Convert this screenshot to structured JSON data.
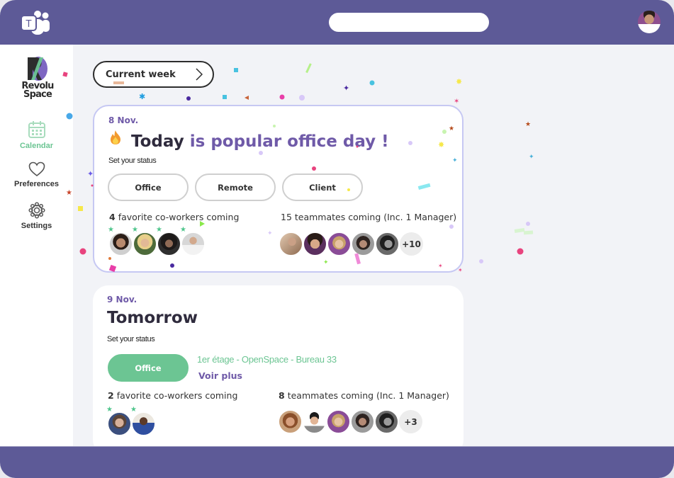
{
  "app": {
    "name": "Microsoft Teams",
    "logo_icon": "teams-logo-icon",
    "search": {
      "placeholder": "",
      "value": ""
    },
    "user_avatar": "user-avatar"
  },
  "sidebar": {
    "brand": {
      "line1": "Revolu",
      "line2": "Space"
    },
    "items": [
      {
        "label": "Calendar",
        "icon": "calendar-icon",
        "active": true
      },
      {
        "label": "Preferences",
        "icon": "heart-icon",
        "active": false
      },
      {
        "label": "Settings",
        "icon": "gear-icon",
        "active": false
      }
    ]
  },
  "week_selector": {
    "label": "Current week",
    "icon": "chevron-right-icon"
  },
  "colors": {
    "teams_purple": "#5d5a97",
    "accent_purple": "#6f5aa8",
    "office_green": "#6cc593",
    "highlight_border": "#c6c8f3"
  },
  "days": [
    {
      "date": "8 Nov.",
      "title_main": "Today",
      "title_accent": "is popular office day !",
      "icon": "fire-icon",
      "status_label": "Set your status",
      "status_options": [
        "Office",
        "Remote",
        "Client"
      ],
      "selected_status": null,
      "favorites": {
        "count": "4",
        "text": "favorite co-workers coming",
        "avatars": 4
      },
      "teammates": {
        "text": "15 teammates coming (Inc. 1 Manager)",
        "avatars": 5,
        "more": "+10"
      }
    },
    {
      "date": "9 Nov.",
      "title_main": "Tomorrow",
      "status_label": "Set your status",
      "selected_status": "Office",
      "location": "1er étage - OpenSpace - Bureau 33",
      "more_link": "Voir plus",
      "favorites": {
        "count": "2",
        "text": "favorite co-workers coming",
        "avatars": 2
      },
      "teammates": {
        "count": "8",
        "text": "teammates coming (Inc. 1 Manager)",
        "avatars": 5,
        "more": "+3"
      }
    }
  ]
}
